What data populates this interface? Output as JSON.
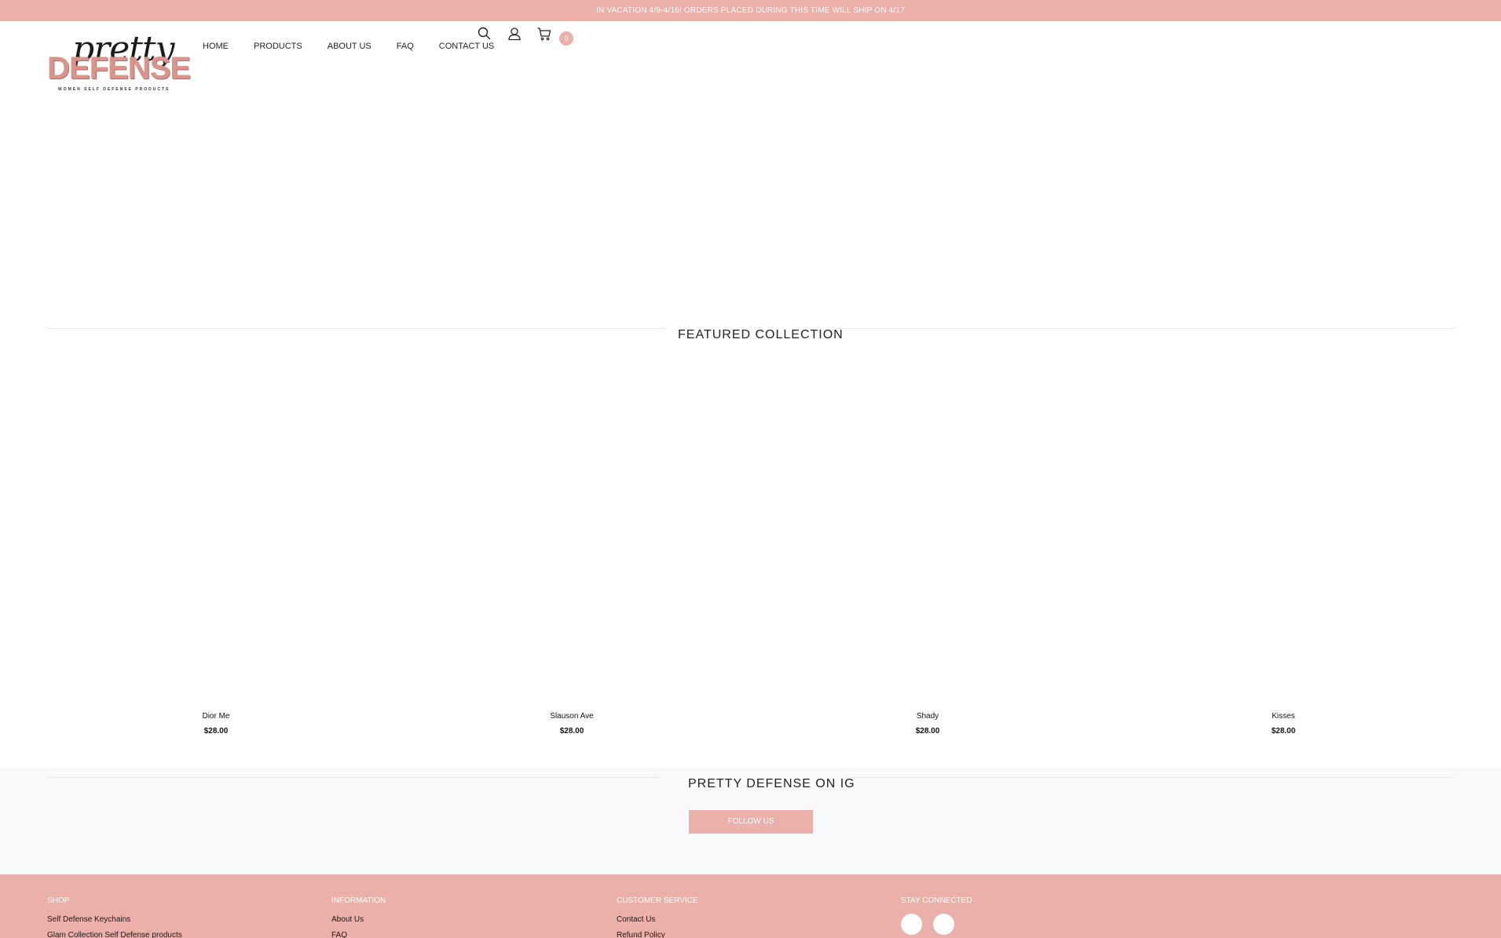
{
  "announcement": "IN VACATION 4/9-4/16! ORDERS PLACED DURING THIS TIME WILL SHIP ON 4/17",
  "logo": {
    "script_text": "pretty",
    "block_text": "DEFENSE",
    "tagline": "WOMEN SELF DEFENSE PRODUCTS"
  },
  "nav": {
    "items": [
      {
        "label": "HOME"
      },
      {
        "label": "PRODUCTS"
      },
      {
        "label": "ABOUT US"
      },
      {
        "label": "FAQ"
      },
      {
        "label": "CONTACT US"
      }
    ]
  },
  "header_icons": {
    "search": "search-icon",
    "account": "user-icon",
    "cart": "cart-icon",
    "cart_count": "0"
  },
  "featured": {
    "title": "FEATURED COLLECTION",
    "products": [
      {
        "name": "Dior Me",
        "price": "$28.00"
      },
      {
        "name": "Slauson Ave",
        "price": "$28.00"
      },
      {
        "name": "Shady",
        "price": "$28.00"
      },
      {
        "name": "Kisses",
        "price": "$28.00"
      }
    ]
  },
  "instagram": {
    "title": "PRETTY DEFENSE ON IG",
    "button_label": "FOLLOW US"
  },
  "footer": {
    "shop": {
      "heading": "SHOP",
      "links": [
        "Self Defense Keychains",
        "Glam Collection Self Defense products"
      ]
    },
    "information": {
      "heading": "INFORMATION",
      "links": [
        "About Us",
        "FAQ"
      ]
    },
    "customer_service": {
      "heading": "CUSTOMER SERVICE",
      "links": [
        "Contact Us",
        "Refund Policy"
      ]
    },
    "stay_connected": {
      "heading": "STAY CONNECTED"
    }
  },
  "colors": {
    "brand_pink": "#ebb0aa",
    "ig_background": "#f8f9fa"
  }
}
